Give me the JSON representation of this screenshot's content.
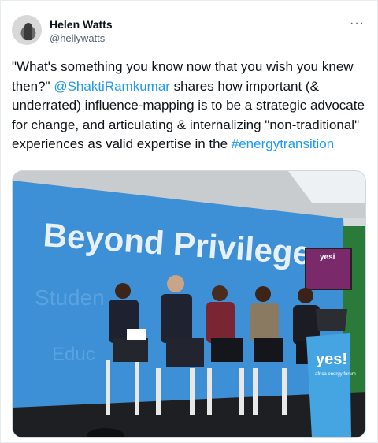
{
  "author": {
    "name": "Helen Watts",
    "handle": "@hellywatts"
  },
  "more_icon": "···",
  "tweet": {
    "part1": "\"What's something you know now that you wish you knew then?\" ",
    "mention": "@ShaktiRamkumar",
    "part2": " shares how important (& underrated) influence-mapping is to be a strategic advocate for change, and articulating & internalizing \"non-traditional\" experiences as valid expertise in the ",
    "hashtag": "#energytransition"
  },
  "photo": {
    "banner_title": "Beyond Privilege",
    "ghost_text_1": "Studen",
    "ghost_text_2": "Educ",
    "screen_logo": "yesi",
    "podium_logo": "yes!",
    "podium_sub": "africa energy forum"
  },
  "colors": {
    "link": "#1d9bf0",
    "banner": "#3d8fd6"
  }
}
